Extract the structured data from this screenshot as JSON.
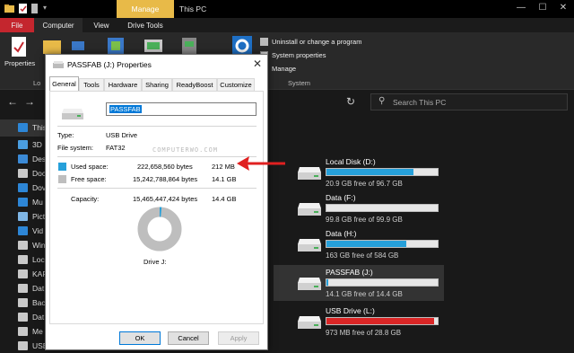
{
  "window": {
    "ribbon_context_tab": "Manage",
    "title": "This PC",
    "tabs": [
      "File",
      "Computer",
      "View",
      "Drive Tools"
    ],
    "controls": [
      "minimize",
      "maximize",
      "close"
    ]
  },
  "ribbon": {
    "properties_label": "Properties",
    "system_group_items": [
      "Uninstall or change a program",
      "System properties",
      "Manage"
    ],
    "group_labels": [
      "Lo",
      "System"
    ]
  },
  "search": {
    "placeholder": "Search This PC"
  },
  "navpane": {
    "items": [
      "This",
      "3D",
      "Des",
      "Doc",
      "Dov",
      "Mu",
      "Pict",
      "Vid",
      "Win",
      "Loc",
      "KAF",
      "Dat",
      "Bac",
      "Dat",
      "Me",
      "USB Drive"
    ]
  },
  "drives": [
    {
      "name": "Local Disk (D:)",
      "free": "20.9 GB free of 96.7 GB",
      "used_fraction": 0.78,
      "color": "#26a0da"
    },
    {
      "name": "Data (F:)",
      "free": "99.8 GB free of 99.9 GB",
      "used_fraction": 0.0,
      "color": "#26a0da"
    },
    {
      "name": "Data (H:)",
      "free": "163 GB free of 584 GB",
      "used_fraction": 0.72,
      "color": "#26a0da"
    },
    {
      "name": "PASSFAB (J:)",
      "free": "14.1 GB free of 14.4 GB",
      "used_fraction": 0.015,
      "color": "#26a0da"
    },
    {
      "name": "USB Drive (L:)",
      "free": "973 MB free of 28.8 GB",
      "used_fraction": 0.97,
      "color": "#da2626"
    }
  ],
  "dialog": {
    "title": "PASSFAB (J:) Properties",
    "tabs": [
      "General",
      "Tools",
      "Hardware",
      "Sharing",
      "ReadyBoost",
      "Customize"
    ],
    "name_value": "PASSFAB",
    "type_label": "Type:",
    "type_value": "USB Drive",
    "fs_label": "File system:",
    "fs_value": "FAT32",
    "used_label": "Used space:",
    "used_bytes": "222,658,560 bytes",
    "used_size": "212 MB",
    "free_label": "Free space:",
    "free_bytes": "15,242,788,864 bytes",
    "free_size": "14.1 GB",
    "capacity_label": "Capacity:",
    "capacity_bytes": "15,465,447,424 bytes",
    "capacity_size": "14.4 GB",
    "drive_label": "Drive J:",
    "used_fraction": 0.0144,
    "used_color": "#26a0da",
    "free_color": "#bebebe",
    "buttons": {
      "ok": "OK",
      "cancel": "Cancel",
      "apply": "Apply"
    }
  },
  "watermark": "COMPUTERWO.COM"
}
